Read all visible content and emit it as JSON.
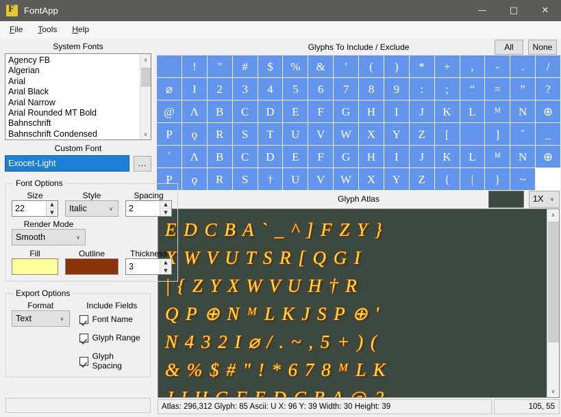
{
  "window": {
    "title": "FontApp",
    "icon": "app-f-icon",
    "minimize": "—",
    "maximize": "□",
    "close": "✕"
  },
  "menubar": {
    "items": [
      {
        "label": "File",
        "accel": "F"
      },
      {
        "label": "Tools",
        "accel": "T"
      },
      {
        "label": "Help",
        "accel": "H"
      }
    ]
  },
  "system_fonts": {
    "label": "System Fonts",
    "items": [
      "Agency FB",
      "Algerian",
      "Arial",
      "Arial Black",
      "Arial Narrow",
      "Arial Rounded MT Bold",
      "Bahnschrift",
      "Bahnschrift Condensed"
    ],
    "scroll_up": "∧",
    "scroll_down": "∨"
  },
  "custom_font": {
    "label": "Custom Font",
    "value": "Exocet-Light",
    "placeholder": "",
    "browse_label": "...",
    "highlight_color": "#1d7fd6"
  },
  "font_options": {
    "legend": "Font Options",
    "size_label": "Size",
    "size_value": "22",
    "style_label": "Style",
    "style_value": "Italic",
    "spacing_label": "Spacing",
    "spacing_value": "2",
    "render_mode_label": "Render Mode",
    "render_mode_value": "Smooth",
    "fill_label": "Fill",
    "fill_color": "#ffff99",
    "outline_label": "Outline",
    "outline_color": "#8b3308",
    "thickness_label": "Thickness",
    "thickness_value": "3",
    "spin_up": "▲",
    "spin_down": "▼",
    "combo_arrow": "∨"
  },
  "export_options": {
    "legend": "Export Options",
    "format_label": "Format",
    "format_value": "Text",
    "include_fields_label": "Include Fields",
    "fields": [
      {
        "label": "Font Name",
        "checked": true
      },
      {
        "label": "Glyph Range",
        "checked": true
      },
      {
        "label": "Glyph Spacing",
        "checked": true
      }
    ]
  },
  "glyph_picker": {
    "title": "Glyphs To Include / Exclude",
    "all_label": "All",
    "none_label": "None",
    "selected_color": "#6495ed",
    "unselected_color": "#ffffff",
    "rows": [
      {
        "cells": [
          {
            "ch": " ",
            "on": true
          },
          {
            "ch": "!",
            "on": true
          },
          {
            "ch": "\"",
            "on": true
          },
          {
            "ch": "#",
            "on": true
          },
          {
            "ch": "$",
            "on": true
          },
          {
            "ch": "%",
            "on": true
          },
          {
            "ch": "&",
            "on": true
          },
          {
            "ch": "'",
            "on": true
          },
          {
            "ch": "(",
            "on": true
          },
          {
            "ch": ")",
            "on": true
          },
          {
            "ch": "*",
            "on": true
          },
          {
            "ch": "+",
            "on": true
          },
          {
            "ch": ",",
            "on": true
          },
          {
            "ch": "-",
            "on": true
          },
          {
            "ch": ".",
            "on": true
          },
          {
            "ch": "/",
            "on": true
          }
        ]
      },
      {
        "cells": [
          {
            "ch": "⌀",
            "on": true
          },
          {
            "ch": "I",
            "on": true
          },
          {
            "ch": "2",
            "on": true
          },
          {
            "ch": "3",
            "on": true
          },
          {
            "ch": "4",
            "on": true
          },
          {
            "ch": "5",
            "on": true
          },
          {
            "ch": "6",
            "on": true
          },
          {
            "ch": "7",
            "on": true
          },
          {
            "ch": "8",
            "on": true
          },
          {
            "ch": "9",
            "on": true
          },
          {
            "ch": ":",
            "on": true
          },
          {
            "ch": ";",
            "on": true
          },
          {
            "ch": "“",
            "on": true
          },
          {
            "ch": "=",
            "on": true
          },
          {
            "ch": "”",
            "on": true
          },
          {
            "ch": "?",
            "on": true
          }
        ]
      },
      {
        "cells": [
          {
            "ch": "@",
            "on": true
          },
          {
            "ch": "Λ",
            "on": true
          },
          {
            "ch": "B",
            "on": true
          },
          {
            "ch": "C",
            "on": true
          },
          {
            "ch": "D",
            "on": true
          },
          {
            "ch": "E",
            "on": true
          },
          {
            "ch": "F",
            "on": true
          },
          {
            "ch": "G",
            "on": true
          },
          {
            "ch": "H",
            "on": true
          },
          {
            "ch": "I",
            "on": true
          },
          {
            "ch": "J",
            "on": true
          },
          {
            "ch": "K",
            "on": true
          },
          {
            "ch": "L",
            "on": true
          },
          {
            "ch": "ᴹ",
            "on": true
          },
          {
            "ch": "N",
            "on": true
          },
          {
            "ch": "⊕",
            "on": true
          }
        ]
      },
      {
        "cells": [
          {
            "ch": "P",
            "on": true
          },
          {
            "ch": "ǫ",
            "on": true
          },
          {
            "ch": "R",
            "on": true
          },
          {
            "ch": "S",
            "on": true
          },
          {
            "ch": "T",
            "on": true
          },
          {
            "ch": "U",
            "on": true
          },
          {
            "ch": "V",
            "on": true
          },
          {
            "ch": "W",
            "on": true
          },
          {
            "ch": "X",
            "on": true
          },
          {
            "ch": "Y",
            "on": true
          },
          {
            "ch": "Z",
            "on": true
          },
          {
            "ch": "[",
            "on": true
          },
          {
            "ch": " ",
            "on": true
          },
          {
            "ch": "]",
            "on": true
          },
          {
            "ch": "ˇ",
            "on": true
          },
          {
            "ch": "_",
            "on": true
          }
        ]
      },
      {
        "cells": [
          {
            "ch": "`",
            "on": true
          },
          {
            "ch": "Λ",
            "on": true
          },
          {
            "ch": "B",
            "on": true
          },
          {
            "ch": "C",
            "on": true
          },
          {
            "ch": "D",
            "on": true
          },
          {
            "ch": "E",
            "on": true
          },
          {
            "ch": "F",
            "on": true
          },
          {
            "ch": "G",
            "on": true
          },
          {
            "ch": "H",
            "on": true
          },
          {
            "ch": "I",
            "on": true
          },
          {
            "ch": "J",
            "on": true
          },
          {
            "ch": "K",
            "on": true
          },
          {
            "ch": "L",
            "on": true
          },
          {
            "ch": "ᴹ",
            "on": true
          },
          {
            "ch": "N",
            "on": true
          },
          {
            "ch": "⊕",
            "on": true
          }
        ]
      },
      {
        "cells": [
          {
            "ch": "P",
            "on": true
          },
          {
            "ch": "ǫ",
            "on": true
          },
          {
            "ch": "R",
            "on": true
          },
          {
            "ch": "S",
            "on": true
          },
          {
            "ch": "†",
            "on": true
          },
          {
            "ch": "U",
            "on": true
          },
          {
            "ch": "V",
            "on": true
          },
          {
            "ch": "W",
            "on": true
          },
          {
            "ch": "X",
            "on": true
          },
          {
            "ch": "Y",
            "on": true
          },
          {
            "ch": "Z",
            "on": true
          },
          {
            "ch": "{",
            "on": true
          },
          {
            "ch": "|",
            "on": true
          },
          {
            "ch": "}",
            "on": true
          },
          {
            "ch": "~",
            "on": true
          },
          {
            "ch": " ",
            "on": false
          }
        ]
      }
    ]
  },
  "glyph_atlas": {
    "title": "Glyph Atlas",
    "background_color": "#3b4a41",
    "zoom_value": "1X",
    "fill_color": "#ffe14d",
    "outline_color": "#8b3308",
    "lines": [
      "E D C B A ` _ ^ ] F  Z Y }",
      "X W V U T S R [ Q G I",
      "| { Z Y X W V U H † R",
      "Q P ⊕ N ᴹ L K J S P ⊕ '",
      "N 4 3  2 I ⌀ / . ~ , 5 + ) (",
      "& % $ # \" ! * 6 7 8 ᴹ L K",
      "J I H G F E D C B A @ ?"
    ],
    "scroll_up": "∧",
    "scroll_down": "∨"
  },
  "statusbar": {
    "info": "Atlas: 296,312   Glyph: 85   Ascii: U   X: 96   Y: 39 Width:   30 Height: 39",
    "atlas_size": "296,312",
    "glyph_index": "85",
    "ascii": "U",
    "x": "96",
    "y": "39",
    "width": "30",
    "height": "39",
    "coords": "105, 55"
  }
}
